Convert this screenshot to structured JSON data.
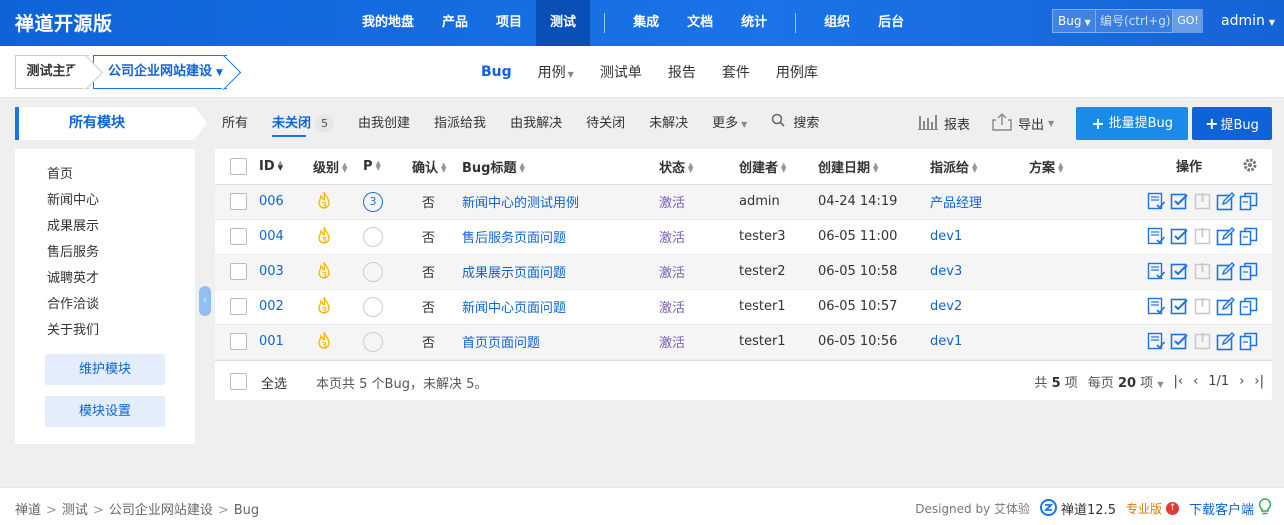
{
  "app": {
    "brand": "禅道开源版",
    "nav": [
      "我的地盘",
      "产品",
      "项目",
      "测试",
      "集成",
      "文档",
      "统计",
      "组织",
      "后台"
    ],
    "nav_active_index": 3,
    "search": {
      "type": "Bug",
      "placeholder": "编号(ctrl+g)",
      "go": "GO!"
    },
    "user": "admin"
  },
  "subheader": {
    "home": "测试主页",
    "project": "公司企业网站建设",
    "tabs": [
      "Bug",
      "用例",
      "测试单",
      "报告",
      "套件",
      "用例库"
    ]
  },
  "filters": {
    "module_tab": "所有模块",
    "items": [
      "所有",
      "未关闭",
      "由我创建",
      "指派给我",
      "由我解决",
      "待关闭",
      "未解决",
      "更多"
    ],
    "unclosed_count": "5",
    "search": "搜索",
    "report": "报表",
    "export": "导出",
    "batch_create": "批量提Bug",
    "create": "提Bug"
  },
  "sidebar": {
    "modules": [
      "首页",
      "新闻中心",
      "成果展示",
      "售后服务",
      "诚聘英才",
      "合作洽谈",
      "关于我们"
    ],
    "maintain": "维护模块",
    "settings": "模块设置"
  },
  "table": {
    "headers": {
      "id": "ID",
      "severity": "级别",
      "pri": "P",
      "confirmed": "确认",
      "title": "Bug标题",
      "status": "状态",
      "creator": "创建者",
      "date": "创建日期",
      "assigned": "指派给",
      "solution": "方案",
      "actions": "操作"
    },
    "rows": [
      {
        "id": "006",
        "severity": "3",
        "pri": "3",
        "confirmed": "否",
        "title": "新闻中心的测试用例",
        "status": "激活",
        "creator": "admin",
        "date": "04-24 14:19",
        "assigned": "产品经理",
        "solution": ""
      },
      {
        "id": "004",
        "severity": "3",
        "pri": "",
        "confirmed": "否",
        "title": "售后服务页面问题",
        "status": "激活",
        "creator": "tester3",
        "date": "06-05 11:00",
        "assigned": "dev1",
        "solution": ""
      },
      {
        "id": "003",
        "severity": "3",
        "pri": "",
        "confirmed": "否",
        "title": "成果展示页面问题",
        "status": "激活",
        "creator": "tester2",
        "date": "06-05 10:58",
        "assigned": "dev3",
        "solution": ""
      },
      {
        "id": "002",
        "severity": "3",
        "pri": "",
        "confirmed": "否",
        "title": "新闻中心页面问题",
        "status": "激活",
        "creator": "tester1",
        "date": "06-05 10:57",
        "assigned": "dev2",
        "solution": ""
      },
      {
        "id": "001",
        "severity": "3",
        "pri": "",
        "confirmed": "否",
        "title": "首页页面问题",
        "status": "激活",
        "creator": "tester1",
        "date": "06-05 10:56",
        "assigned": "dev1",
        "solution": ""
      }
    ],
    "footer": {
      "select_all": "全选",
      "summary": "本页共 5 个Bug，未解决 5。",
      "total_prefix": "共",
      "total": "5",
      "total_suffix": "项",
      "per_page_prefix": "每页",
      "per_page": "20",
      "per_page_suffix": "项",
      "page": "1/1"
    }
  },
  "footer": {
    "breadcrumb": [
      "禅道",
      "测试",
      "公司企业网站建设",
      "Bug"
    ],
    "designed_by": "Designed by 艾体验",
    "version": "禅道12.5",
    "pro": "专业版",
    "download": "下载客户端"
  },
  "colors": {
    "brand_blue": "#1a73e8",
    "status_purple": "#7b5fb5",
    "severity_yellow": "#f5b800"
  }
}
